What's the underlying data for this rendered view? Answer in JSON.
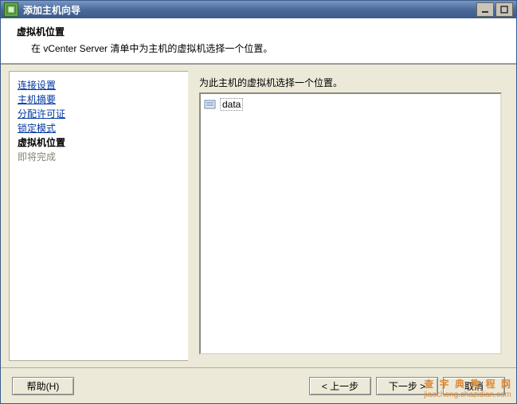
{
  "window": {
    "title": "添加主机向导"
  },
  "header": {
    "title": "虚拟机位置",
    "description": "在 vCenter Server 清单中为主机的虚拟机选择一个位置。"
  },
  "sidebar": {
    "steps": [
      {
        "label": "连接设置",
        "state": "link"
      },
      {
        "label": "主机摘要",
        "state": "link"
      },
      {
        "label": "分配许可证",
        "state": "link"
      },
      {
        "label": "锁定模式",
        "state": "link"
      },
      {
        "label": "虚拟机位置",
        "state": "current"
      },
      {
        "label": "即将完成",
        "state": "pending"
      }
    ]
  },
  "main": {
    "prompt": "为此主机的虚拟机选择一个位置。",
    "tree": [
      {
        "label": "data",
        "icon": "datacenter"
      }
    ]
  },
  "buttons": {
    "help": "帮助(H)",
    "back": "< 上一步",
    "next": "下一步 >",
    "cancel": "取消"
  }
}
